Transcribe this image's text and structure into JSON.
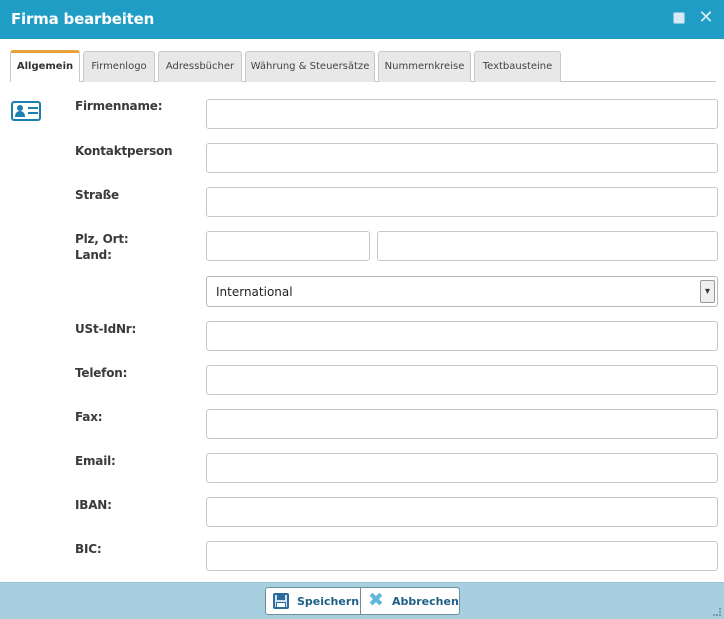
{
  "dialog": {
    "title": "Firma bearbeiten",
    "title_icons": [
      "maximize-icon",
      "close-icon"
    ],
    "colors": {
      "titlebar": "#1f9dc5",
      "footer": "#a8cfe0",
      "active_tab_accent": "#e9a13a"
    }
  },
  "tabs": [
    {
      "label": "Allgemein",
      "active": true
    },
    {
      "label": "Firmenlogo"
    },
    {
      "label": "Adressbücher"
    },
    {
      "label": "Währung & Steuersätze"
    },
    {
      "label": "Nummernkreise"
    },
    {
      "label": "Textbausteine"
    }
  ],
  "form": {
    "firmenname": {
      "label": "Firmenname:",
      "value": ""
    },
    "kontaktperson": {
      "label": "Kontaktperson",
      "value": ""
    },
    "strasse": {
      "label": "Straße",
      "value": ""
    },
    "plz_ort": {
      "label": "Plz, Ort:",
      "plz": "",
      "ort": ""
    },
    "land": {
      "label": "Land:",
      "selected": "International"
    },
    "ustidnr": {
      "label": "USt-IdNr:",
      "value": ""
    },
    "telefon": {
      "label": "Telefon:",
      "value": ""
    },
    "fax": {
      "label": "Fax:",
      "value": ""
    },
    "email": {
      "label": "Email:",
      "value": ""
    },
    "iban": {
      "label": "IBAN:",
      "value": ""
    },
    "bic": {
      "label": "BIC:",
      "value": ""
    }
  },
  "footer": {
    "save_label": "Speichern",
    "cancel_label": "Abbrechen"
  }
}
